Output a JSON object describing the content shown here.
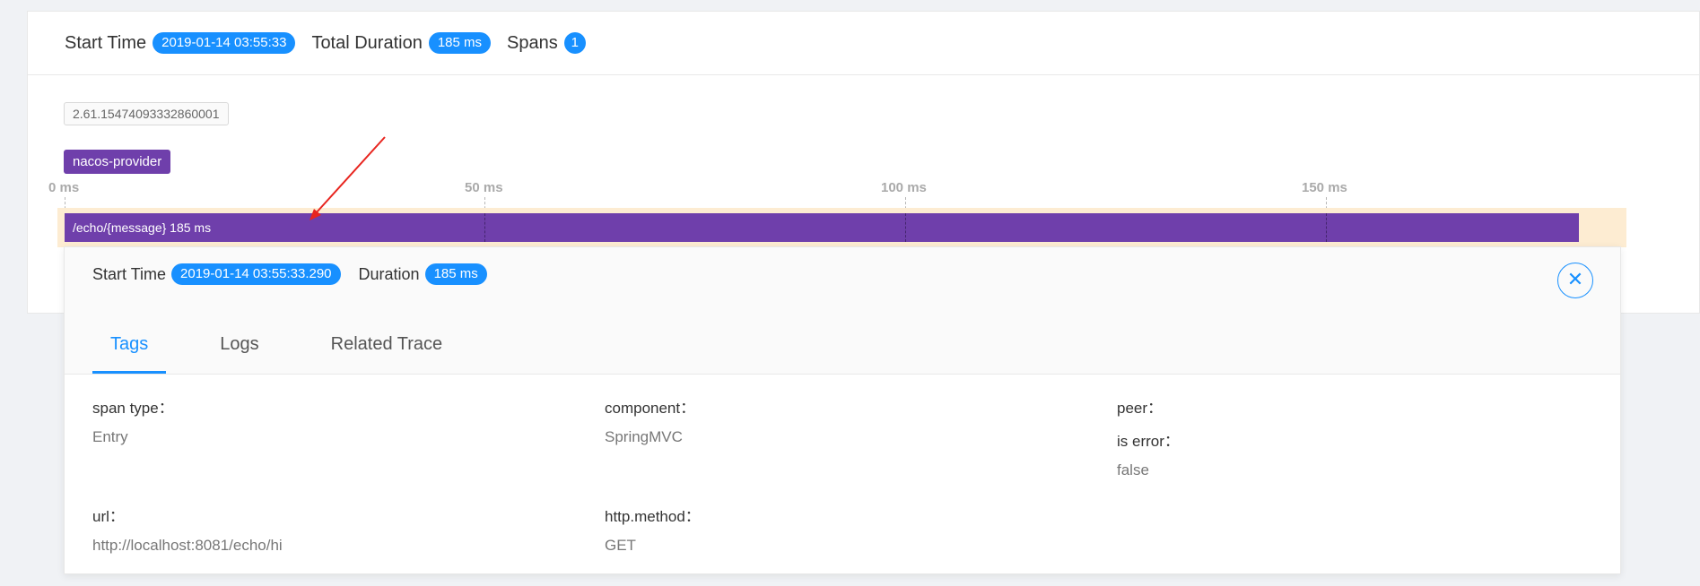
{
  "trace_header": {
    "start_time_label": "Start Time",
    "start_time": "2019-01-14 03:55:33",
    "total_duration_label": "Total Duration",
    "total_duration": "185 ms",
    "spans_label": "Spans",
    "spans": "1"
  },
  "trace_id": "2.61.15474093332860001",
  "service": "nacos-provider",
  "axis": [
    "0 ms",
    "50 ms",
    "100 ms",
    "150 ms"
  ],
  "span": {
    "label": "/echo/{message} 185 ms",
    "color": "#6f3fab"
  },
  "detail": {
    "start_time_label": "Start Time",
    "start_time": "2019-01-14 03:55:33.290",
    "duration_label": "Duration",
    "duration": "185 ms",
    "close_icon": "close-icon",
    "tabs": [
      "Tags",
      "Logs",
      "Related Trace"
    ],
    "active_tab": "Tags",
    "tags": [
      {
        "key": "span type：",
        "values": [
          "Entry"
        ]
      },
      {
        "key": "component：",
        "values": [
          "SpringMVC"
        ]
      },
      {
        "key": "peer：",
        "values": []
      },
      {
        "key": "is error：",
        "values": [
          "false"
        ]
      },
      {
        "key": "url：",
        "values": [
          "http://localhost:8081/echo/hi"
        ]
      },
      {
        "key": "http.method：",
        "values": [
          "GET"
        ]
      }
    ]
  },
  "colors": {
    "accent": "#1890ff",
    "span": "#6f3fab",
    "row_highlight": "#fdecd2",
    "arrow": "#e8251f"
  }
}
